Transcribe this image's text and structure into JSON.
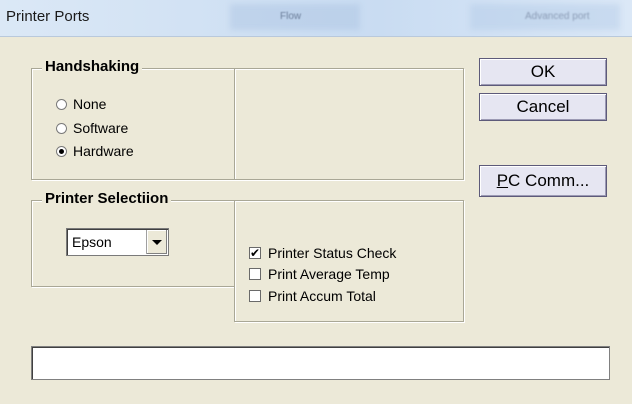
{
  "window": {
    "title": "Printer Ports",
    "blurred_tab_1": "Flow",
    "blurred_tab_2": "Advanced port"
  },
  "handshaking": {
    "legend": "Handshaking",
    "options": [
      {
        "label": "None",
        "checked": false
      },
      {
        "label": "Software",
        "checked": false
      },
      {
        "label": "Hardware",
        "checked": true
      }
    ]
  },
  "printer_selection": {
    "legend": "Printer Selectiion",
    "selected": "Epson"
  },
  "options": [
    {
      "label": "Printer Status Check",
      "checked": true
    },
    {
      "label": "Print Average Temp",
      "checked": false
    },
    {
      "label": "Print Accum Total",
      "checked": false
    }
  ],
  "buttons": {
    "ok": "OK",
    "cancel": "Cancel",
    "pc_comm_mnemonic": "P",
    "pc_comm_rest": "C Comm..."
  },
  "status_text": ""
}
